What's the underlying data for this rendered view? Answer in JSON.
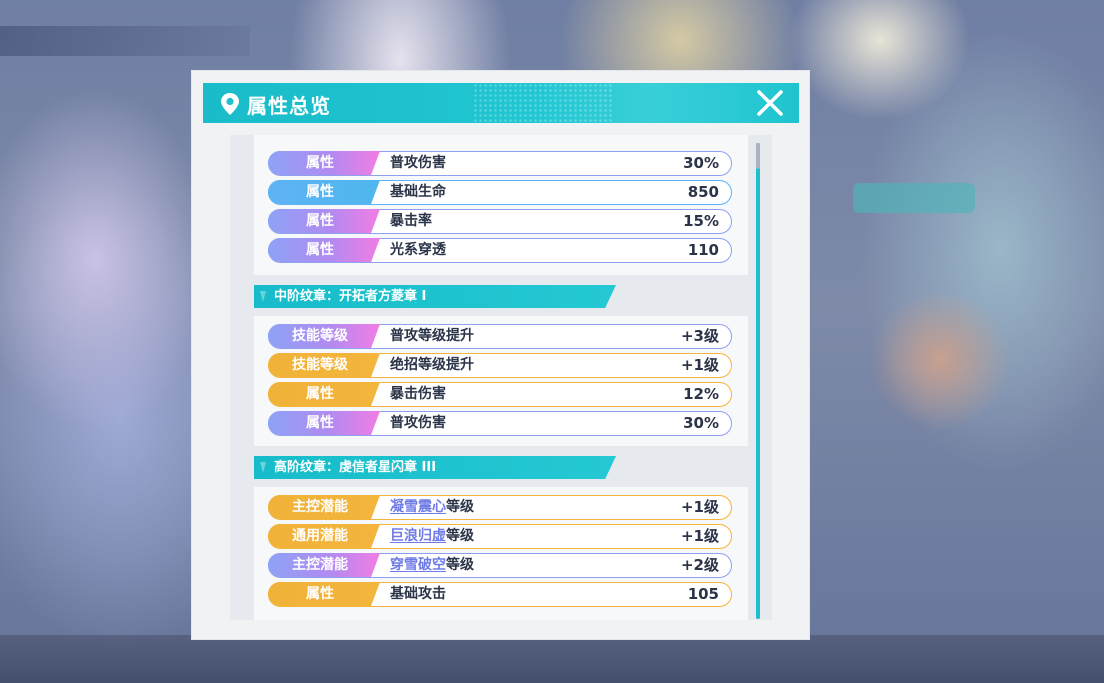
{
  "dialog": {
    "title": "属性总览"
  },
  "group1": {
    "rows": [
      {
        "tag": "属性",
        "label": "普攻伤害",
        "value": "30%"
      },
      {
        "tag": "属性",
        "label": "基础生命",
        "value": "850"
      },
      {
        "tag": "属性",
        "label": "暴击率",
        "value": "15%"
      },
      {
        "tag": "属性",
        "label": "光系穿透",
        "value": "110"
      }
    ]
  },
  "group2": {
    "title": "中阶纹章：开拓者方菱章 I",
    "rows": [
      {
        "tag": "技能等级",
        "label": "普攻等级提升",
        "value": "+3级"
      },
      {
        "tag": "技能等级",
        "label": "绝招等级提升",
        "value": "+1级"
      },
      {
        "tag": "属性",
        "label": "暴击伤害",
        "value": "12%"
      },
      {
        "tag": "属性",
        "label": "普攻伤害",
        "value": "30%"
      }
    ]
  },
  "group3": {
    "title": "高阶纹章：虔信者星闪章 III",
    "rows": [
      {
        "tag": "主控潜能",
        "link": "凝雪震心",
        "suffix": "等级",
        "value": "+1级"
      },
      {
        "tag": "通用潜能",
        "link": "巨浪归虚",
        "suffix": "等级",
        "value": "+1级"
      },
      {
        "tag": "主控潜能",
        "link": "穿雪破空",
        "suffix": "等级",
        "value": "+2级"
      },
      {
        "tag": "属性",
        "label": "基础攻击",
        "value": "105"
      }
    ]
  },
  "colors": {
    "header": "#1ec4cf",
    "tag_purple": "#b18bf1",
    "tag_blue": "#4fb6ee",
    "tag_gold": "#f2b43a",
    "link": "#6f7be6"
  }
}
